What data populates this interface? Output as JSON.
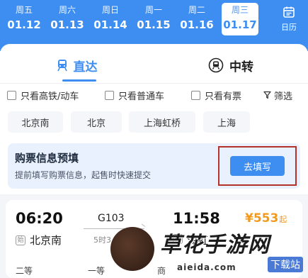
{
  "dates": [
    {
      "weekday": "周五",
      "date": "01.12"
    },
    {
      "weekday": "周六",
      "date": "01.13"
    },
    {
      "weekday": "周日",
      "date": "01.14"
    },
    {
      "weekday": "周一",
      "date": "01.15"
    },
    {
      "weekday": "周二",
      "date": "01.16"
    },
    {
      "weekday": "周三",
      "date": "01.17"
    }
  ],
  "selected_date_index": 5,
  "calendar_label": "日历",
  "tabs": [
    {
      "label": "直达"
    },
    {
      "label": "中转"
    }
  ],
  "filters": [
    {
      "label": "只看高铁/动车",
      "checked": false
    },
    {
      "label": "只看普通车",
      "checked": false
    },
    {
      "label": "只看有票",
      "checked": false
    }
  ],
  "filter_button": "筛选",
  "stations": [
    "北京南",
    "北京",
    "上海虹桥",
    "上海"
  ],
  "prefill": {
    "title": "购票信息预填",
    "desc": "提前填写购票信息，起售时快速提交",
    "button": "去填写"
  },
  "train": {
    "dep_time": "06:20",
    "arr_time": "11:58",
    "train_no": "G103",
    "duration": "5时3",
    "price": "¥553",
    "price_suffix": "起",
    "dep_station": "北京南",
    "arr_station": "海虹",
    "start_badge": "始",
    "end_badge": "终",
    "seats": [
      "二等",
      "一等",
      "商"
    ]
  },
  "watermark": {
    "text1": "草花手游网",
    "text2": "下载站",
    "text3": "aieida.com"
  },
  "colors": {
    "accent": "#3d8ef0",
    "price": "#f29a1c",
    "highlight_border": "#b3322a"
  }
}
